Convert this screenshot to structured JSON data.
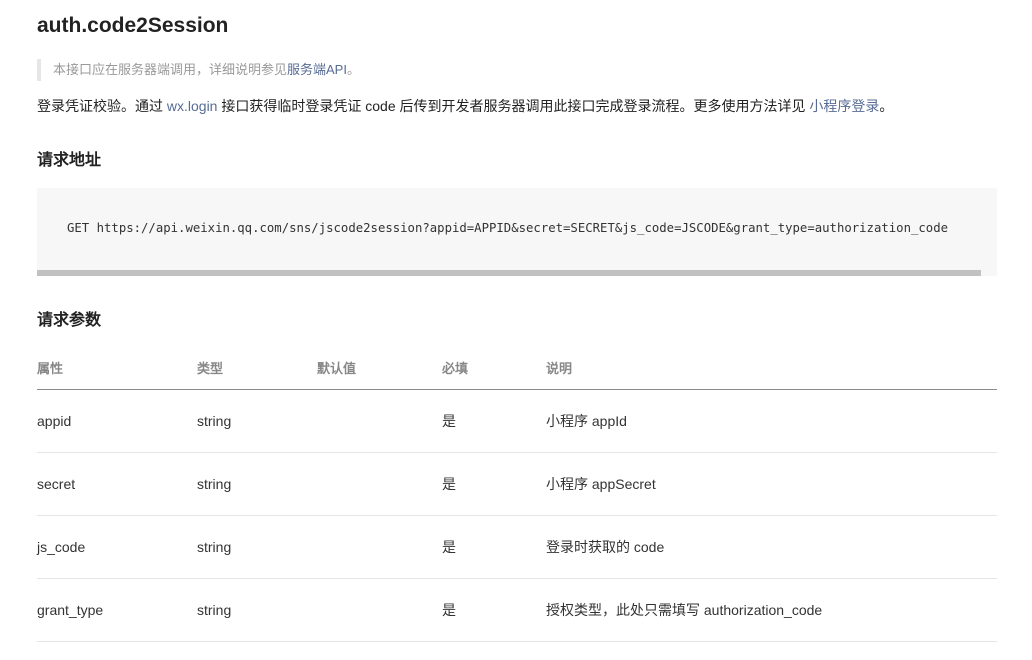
{
  "page": {
    "title": "auth.code2Session",
    "note": {
      "text": "本接口应在服务器端调用，详细说明参见",
      "link": "服务端API",
      "suffix": "。"
    },
    "description": {
      "part1": "登录凭证校验。通过 ",
      "link1": "wx.login",
      "part2": " 接口获得临时登录凭证 code 后传到开发者服务器调用此接口完成登录流程。更多使用方法详见 ",
      "link2": "小程序登录",
      "part3": "。"
    }
  },
  "request_url": {
    "heading": "请求地址",
    "code": "GET https://api.weixin.qq.com/sns/jscode2session?appid=APPID&secret=SECRET&js_code=JSCODE&grant_type=authorization_code"
  },
  "params": {
    "heading": "请求参数",
    "headers": [
      "属性",
      "类型",
      "默认值",
      "必填",
      "说明"
    ],
    "rows": [
      [
        "appid",
        "string",
        "",
        "是",
        "小程序 appId"
      ],
      [
        "secret",
        "string",
        "",
        "是",
        "小程序 appSecret"
      ],
      [
        "js_code",
        "string",
        "",
        "是",
        "登录时获取的 code"
      ],
      [
        "grant_type",
        "string",
        "",
        "是",
        "授权类型，此处只需填写 authorization_code"
      ]
    ]
  },
  "colors": {
    "link": "#576b95",
    "code_bg": "#f7f7f7",
    "muted": "#999999"
  }
}
